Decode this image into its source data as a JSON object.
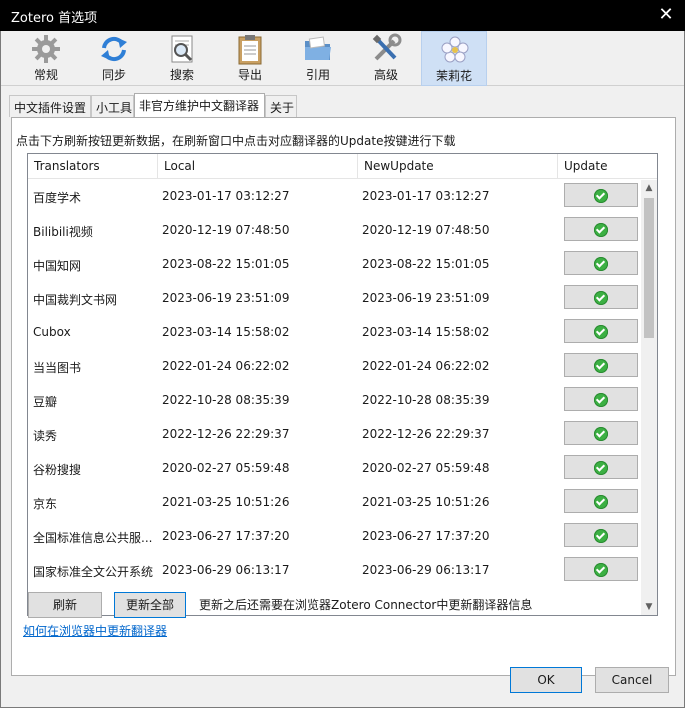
{
  "window": {
    "title": "Zotero 首选项",
    "close_glyph": "✕"
  },
  "toolbar": [
    {
      "label": "常规",
      "icon": "gear-icon"
    },
    {
      "label": "同步",
      "icon": "sync-icon"
    },
    {
      "label": "搜索",
      "icon": "search-icon"
    },
    {
      "label": "导出",
      "icon": "clipboard-icon"
    },
    {
      "label": "引用",
      "icon": "folder-icon"
    },
    {
      "label": "高级",
      "icon": "tools-icon"
    },
    {
      "label": "茉莉花",
      "icon": "flower-icon",
      "selected": true
    }
  ],
  "tabs": [
    {
      "label": "中文插件设置"
    },
    {
      "label": "小工具"
    },
    {
      "label": "非官方维护中文翻译器",
      "active": true
    },
    {
      "label": "关于"
    }
  ],
  "hint": "点击下方刷新按钮更新数据，在刷新窗口中点击对应翻译器的Update按键进行下载",
  "list": {
    "headers": [
      "Translators",
      "Local",
      "NewUpdate",
      "Update"
    ],
    "rows": [
      {
        "name": "百度学术",
        "local": "2023-01-17 03:12:27",
        "new": "2023-01-17 03:12:27"
      },
      {
        "name": "Bilibili视频",
        "local": "2020-12-19 07:48:50",
        "new": "2020-12-19 07:48:50"
      },
      {
        "name": "中国知网",
        "local": "2023-08-22 15:01:05",
        "new": "2023-08-22 15:01:05"
      },
      {
        "name": "中国裁判文书网",
        "local": "2023-06-19 23:51:09",
        "new": "2023-06-19 23:51:09"
      },
      {
        "name": "Cubox",
        "local": "2023-03-14 15:58:02",
        "new": "2023-03-14 15:58:02"
      },
      {
        "name": "当当图书",
        "local": "2022-01-24 06:22:02",
        "new": "2022-01-24 06:22:02"
      },
      {
        "name": "豆瓣",
        "local": "2022-10-28 08:35:39",
        "new": "2022-10-28 08:35:39"
      },
      {
        "name": "读秀",
        "local": "2022-12-26 22:29:37",
        "new": "2022-12-26 22:29:37"
      },
      {
        "name": "谷粉搜搜",
        "local": "2020-02-27 05:59:48",
        "new": "2020-02-27 05:59:48"
      },
      {
        "name": "京东",
        "local": "2021-03-25 10:51:26",
        "new": "2021-03-25 10:51:26"
      },
      {
        "name": "全国标准信息公共服...",
        "local": "2023-06-27 17:37:20",
        "new": "2023-06-27 17:37:20"
      },
      {
        "name": "国家标准全文公开系统",
        "local": "2023-06-29 06:13:17",
        "new": "2023-06-29 06:13:17"
      }
    ],
    "scroll_up": "▲",
    "scroll_down": "▼"
  },
  "buttons": {
    "refresh": "刷新",
    "update_all": "更新全部",
    "ok": "OK",
    "cancel": "Cancel"
  },
  "note": "更新之后还需要在浏览器Zotero Connector中更新翻译器信息",
  "link": "如何在浏览器中更新翻译器",
  "colors": {
    "selected_toolbar": "#cfe0f5",
    "check_green": "#3cb043",
    "link": "#0066cc",
    "focus_border": "#0078d7"
  }
}
